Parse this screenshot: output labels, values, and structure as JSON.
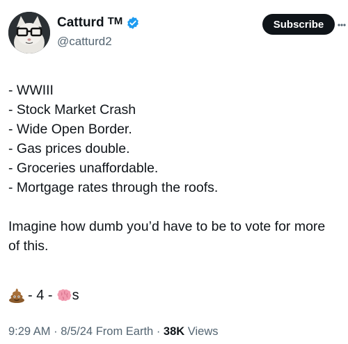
{
  "tweet": {
    "author_name": "Catturd",
    "author_tm": "TM",
    "handle": "@catturd2",
    "subscribe_label": "Subscribe",
    "more_icon": "more-icon",
    "lines": [
      "- WWIII",
      "- Stock Market Crash",
      "- Wide Open Border.",
      "- Gas prices double.",
      "- Groceries unaffordable.",
      "- Mortgage rates through the roofs."
    ],
    "paragraph": "Imagine how dumb you’d have to be to vote for more of this.",
    "emoji_sep_1": "- 4 -",
    "emoji_suffix": "s",
    "time": "9:29 AM",
    "date": "8/5/24",
    "source": "From Earth",
    "views_count": "38K",
    "views_label": "Views",
    "sep": "·"
  },
  "colors": {
    "text": "#0f1419",
    "secondary": "#536471",
    "verified": "#1d9bf0",
    "button": "#0f1419"
  }
}
